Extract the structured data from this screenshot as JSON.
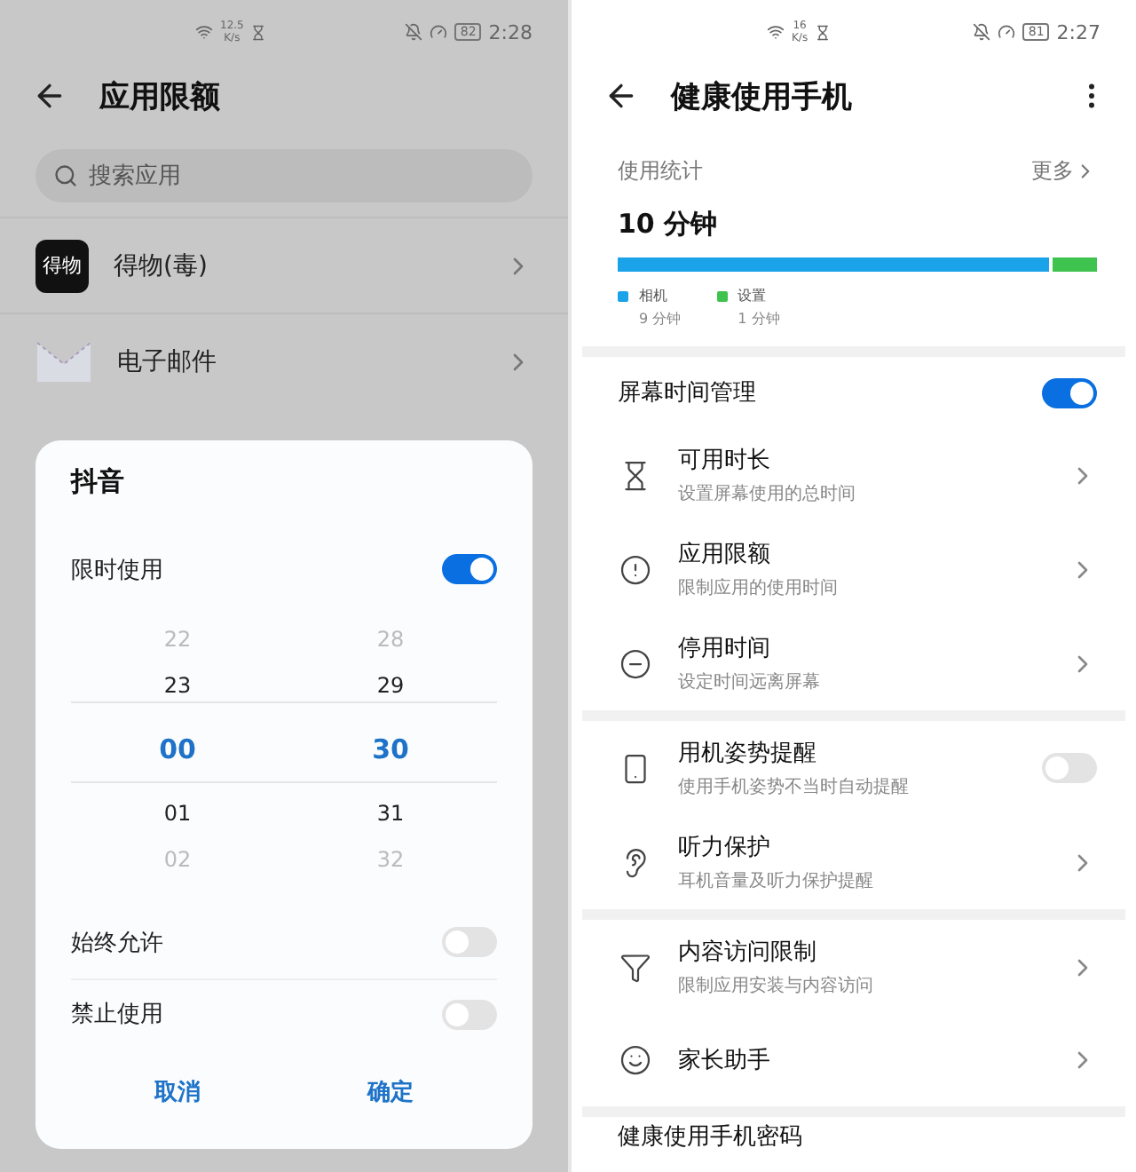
{
  "left_screen": {
    "status_bar": {
      "speed": "12.5",
      "speed_unit": "K/s",
      "battery": "82",
      "time": "2:28"
    },
    "header": {
      "title": "应用限额"
    },
    "search": {
      "placeholder": "搜索应用"
    },
    "apps": [
      {
        "name": "得物(毒)",
        "logo_text": "得物",
        "kind": "logo"
      },
      {
        "name": "电子邮件",
        "kind": "mail"
      }
    ],
    "dialog": {
      "title": "抖音",
      "limit_toggle": {
        "label": "限时使用",
        "on": true
      },
      "picker": [
        {
          "items": [
            {
              "text": "22",
              "selected": false
            },
            {
              "text": "23",
              "selected": false
            },
            {
              "text": "00",
              "selected": true
            },
            {
              "text": "01",
              "selected": false
            },
            {
              "text": "02",
              "selected": false
            }
          ]
        },
        {
          "items": [
            {
              "text": "28",
              "selected": false
            },
            {
              "text": "29",
              "selected": false
            },
            {
              "text": "30",
              "selected": true
            },
            {
              "text": "31",
              "selected": false
            },
            {
              "text": "32",
              "selected": false
            }
          ]
        }
      ],
      "options": [
        {
          "label": "始终允许",
          "on": false
        },
        {
          "label": "禁止使用",
          "on": false
        }
      ],
      "buttons": [
        "取消",
        "确定"
      ]
    }
  },
  "right_screen": {
    "status_bar": {
      "speed": "16",
      "speed_unit": "K/s",
      "battery": "81",
      "time": "2:27"
    },
    "header": {
      "title": "健康使用手机"
    },
    "usage": {
      "label": "使用统计",
      "more": "更多",
      "total": "10 分钟",
      "segments": [
        {
          "name": "相机",
          "time": "9 分钟",
          "level": 0.9,
          "color": "#1aa3e8"
        },
        {
          "name": "设置",
          "time": "1 分钟",
          "level": 0.1,
          "color": "#3fc34f"
        }
      ]
    },
    "sections": [
      {
        "items": [
          {
            "kind": "toggle_header",
            "title": "屏幕时间管理",
            "on": true
          },
          {
            "kind": "link",
            "title": "可用时长",
            "subtitle": "设置屏幕使用的总时间"
          },
          {
            "kind": "link",
            "title": "应用限额",
            "subtitle": "限制应用的使用时间"
          },
          {
            "kind": "link",
            "title": "停用时间",
            "subtitle": "设定时间远离屏幕"
          }
        ]
      },
      {
        "items": [
          {
            "kind": "toggle",
            "title": "用机姿势提醒",
            "subtitle": "使用手机姿势不当时自动提醒",
            "on": false
          },
          {
            "kind": "link",
            "title": "听力保护",
            "subtitle": "耳机音量及听力保护提醒"
          }
        ]
      },
      {
        "items": [
          {
            "kind": "link",
            "title": "内容访问限制",
            "subtitle": "限制应用安装与内容访问"
          },
          {
            "kind": "link",
            "title": "家长助手"
          }
        ]
      },
      {
        "items": [
          {
            "kind": "plain",
            "title": "健康使用手机密码"
          }
        ]
      }
    ]
  }
}
